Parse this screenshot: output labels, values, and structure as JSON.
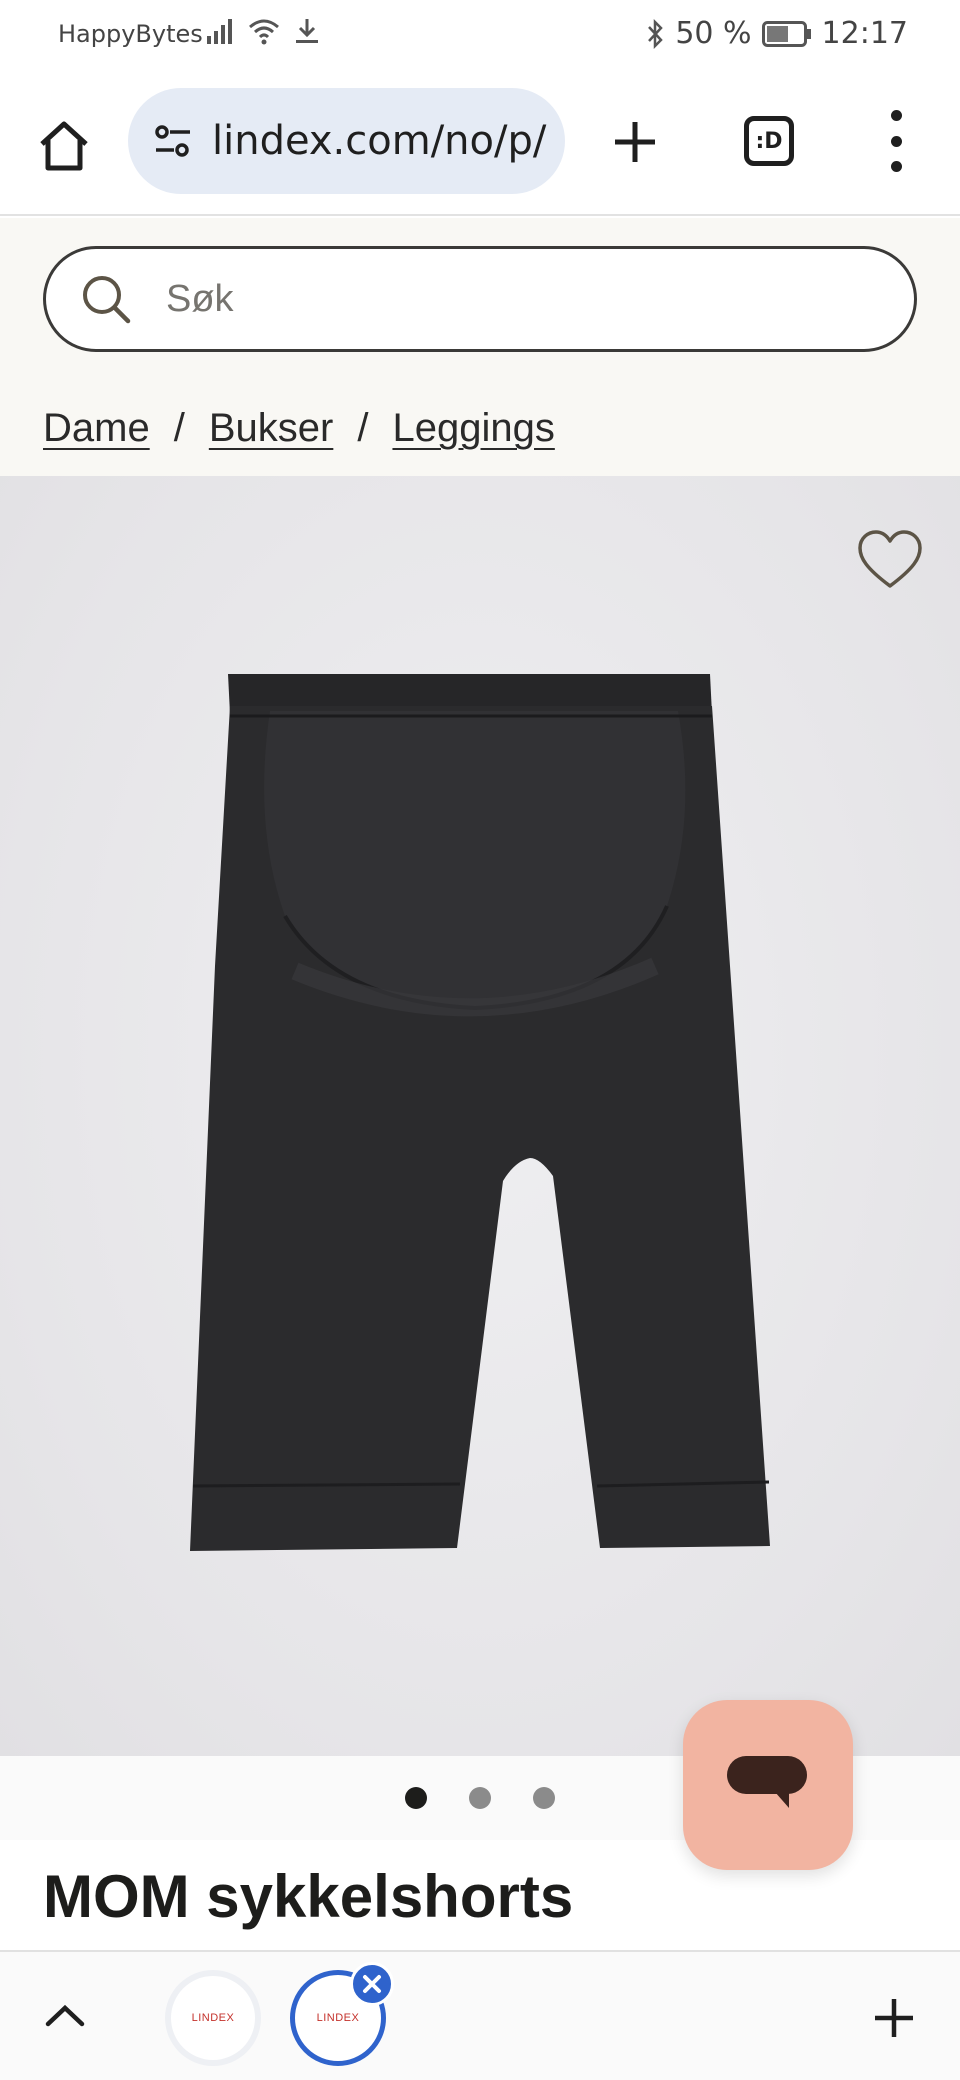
{
  "status_bar": {
    "carrier": "HappyBytes",
    "battery": "50 %",
    "time": "12:17"
  },
  "browser": {
    "url": "lindex.com/no/p/",
    "tab_count_label": ":D"
  },
  "page": {
    "search": {
      "placeholder": "Søk"
    },
    "breadcrumb": [
      {
        "label": "Dame"
      },
      {
        "label": "Bukser"
      },
      {
        "label": "Leggings"
      }
    ],
    "breadcrumb_separator": "/",
    "product": {
      "title": "MOM sykkelshorts",
      "image_count": 3,
      "active_image": 1,
      "garment_color": "#2b2b2d"
    }
  },
  "tab_strip": {
    "tabs": [
      {
        "favicon_text": "LINDEX"
      },
      {
        "favicon_text": "LINDEX"
      }
    ]
  },
  "colors": {
    "url_bar": "#e5ebf5",
    "chat_button": "#f2b4a1",
    "active_tab": "#2f63cc"
  }
}
